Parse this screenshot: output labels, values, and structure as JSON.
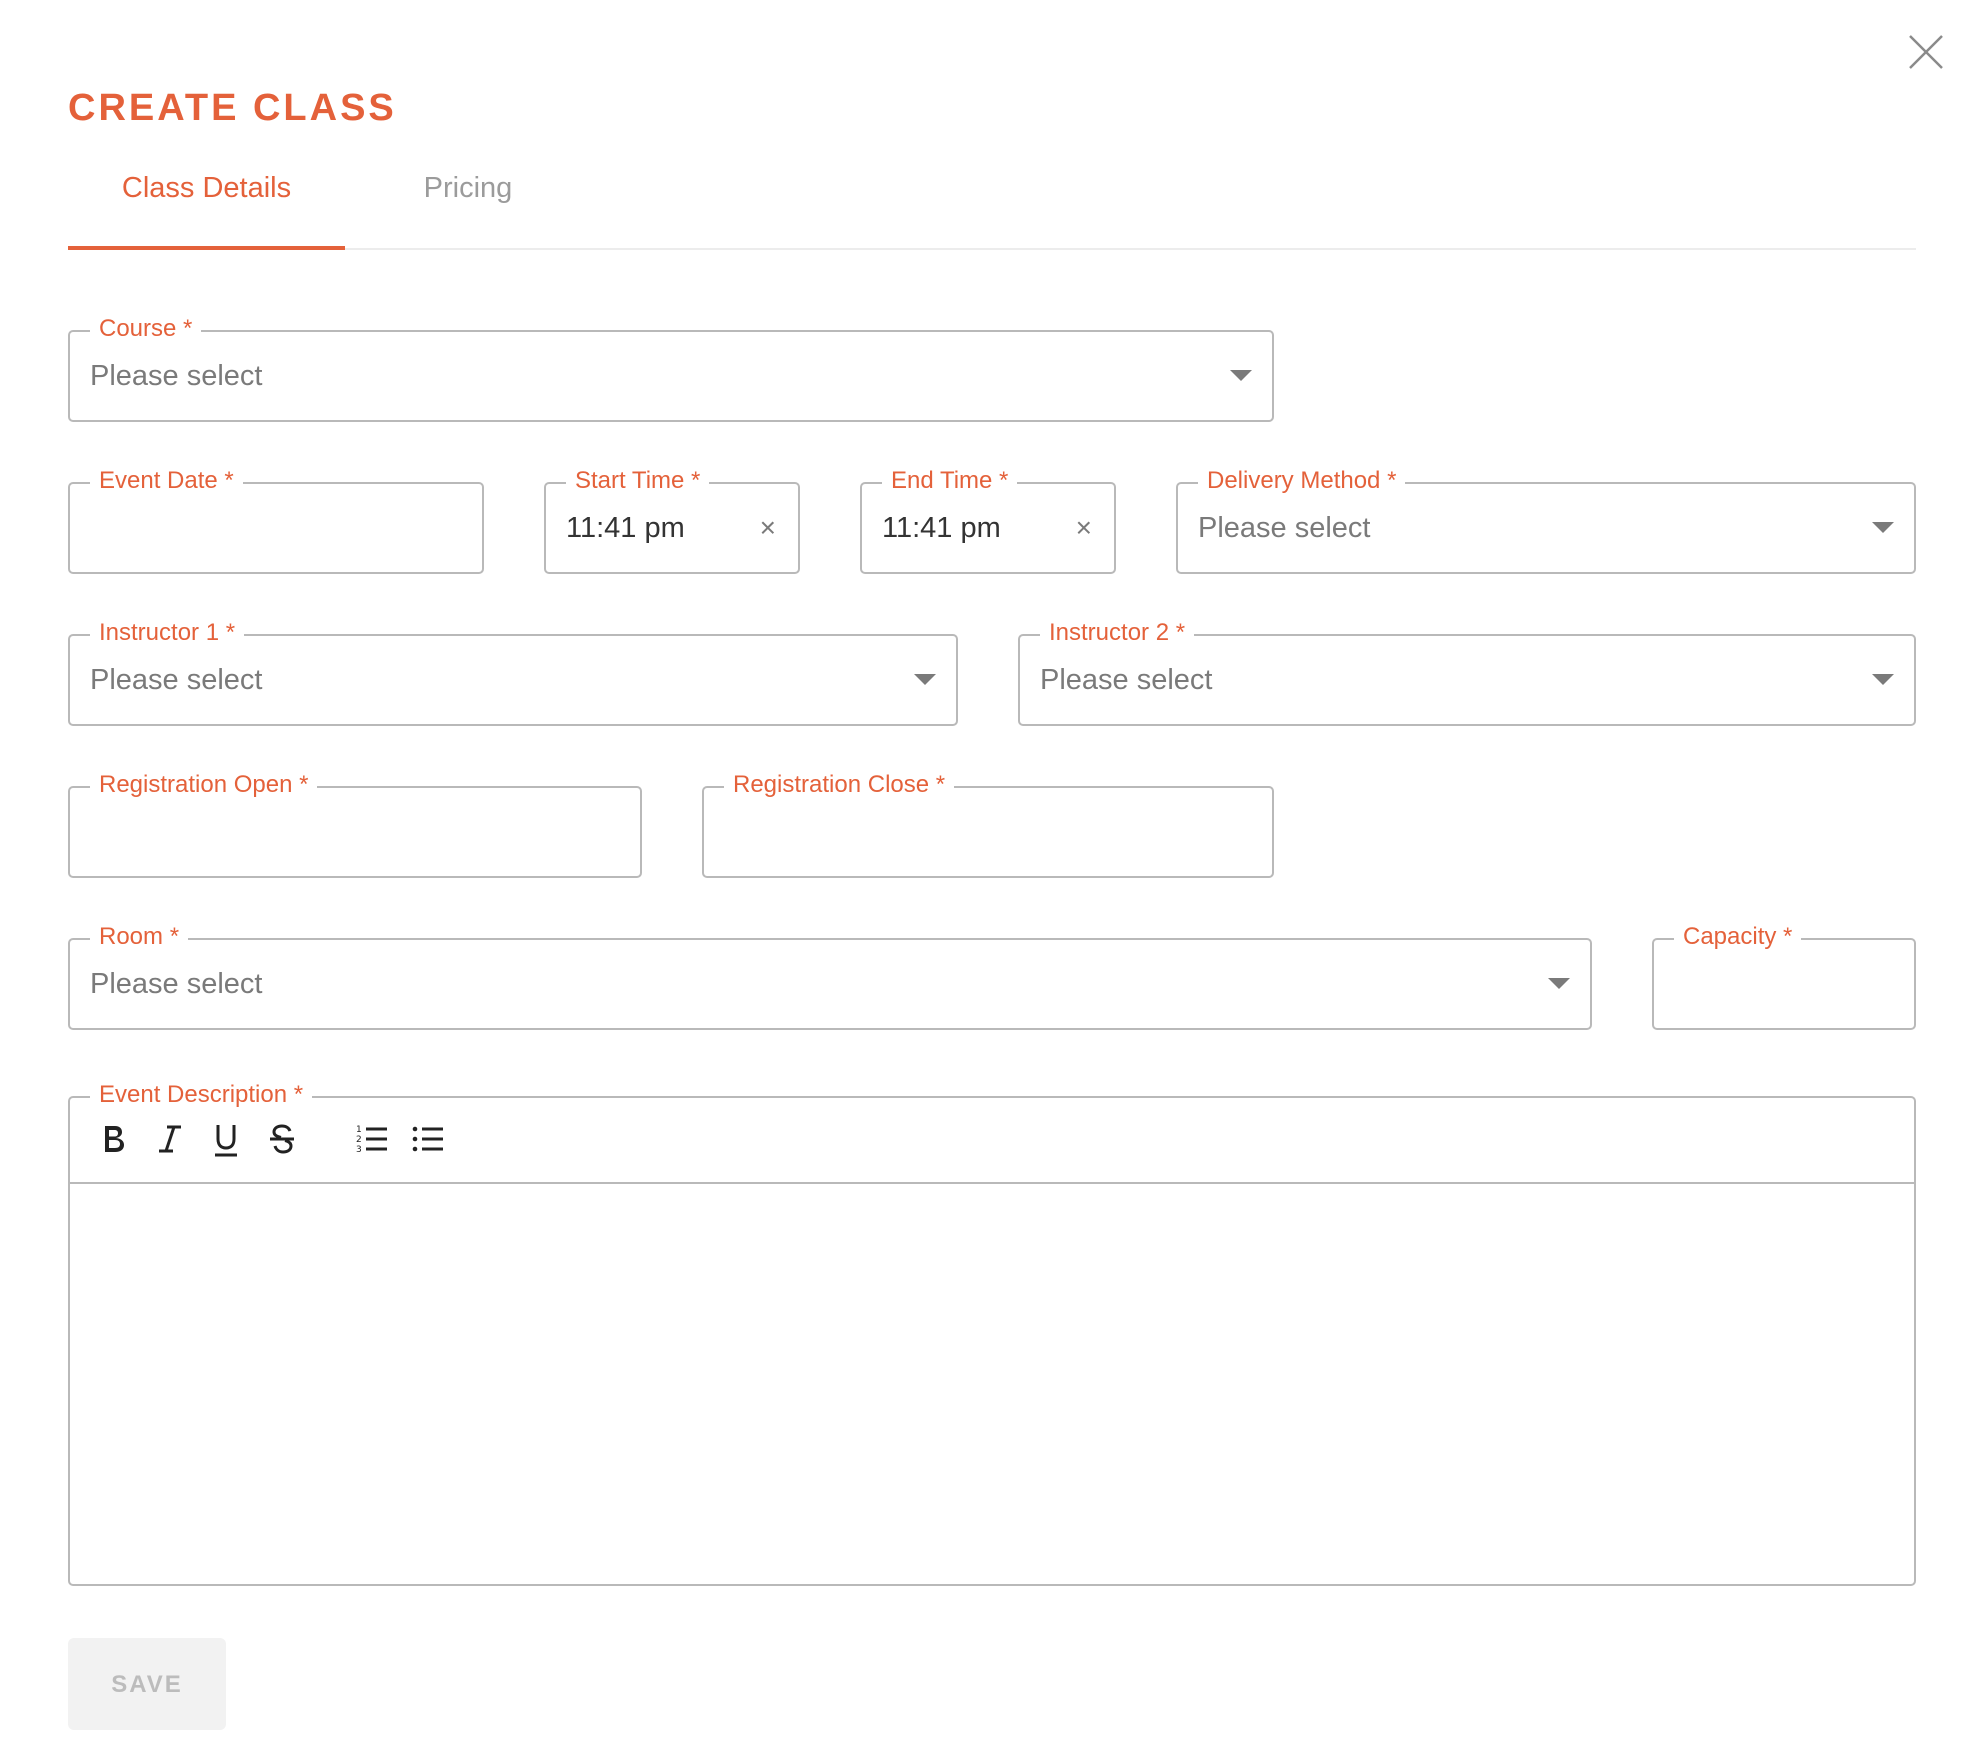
{
  "dialog": {
    "title": "CREATE CLASS",
    "close_icon": "close-icon"
  },
  "tabs": [
    {
      "label": "Class Details",
      "active": true
    },
    {
      "label": "Pricing",
      "active": false
    }
  ],
  "fields": {
    "course": {
      "label": "Course *",
      "placeholder": "Please select"
    },
    "event_date": {
      "label": "Event Date *",
      "value": ""
    },
    "start_time": {
      "label": "Start Time *",
      "value": "11:41 pm",
      "clear_glyph": "×"
    },
    "end_time": {
      "label": "End Time *",
      "value": "11:41 pm",
      "clear_glyph": "×"
    },
    "delivery_method": {
      "label": "Delivery Method *",
      "placeholder": "Please select"
    },
    "instructor_1": {
      "label": "Instructor 1 *",
      "placeholder": "Please select"
    },
    "instructor_2": {
      "label": "Instructor 2 *",
      "placeholder": "Please select"
    },
    "registration_open": {
      "label": "Registration Open *",
      "value": ""
    },
    "registration_close": {
      "label": "Registration Close *",
      "value": ""
    },
    "room": {
      "label": "Room *",
      "placeholder": "Please select"
    },
    "capacity": {
      "label": "Capacity *",
      "value": ""
    },
    "event_description": {
      "label": "Event Description *",
      "toolbar": [
        "bold-icon",
        "italic-icon",
        "underline-icon",
        "strikethrough-icon",
        "ordered-list-icon",
        "bullet-list-icon"
      ]
    }
  },
  "actions": {
    "save_label": "SAVE"
  },
  "colors": {
    "accent": "#e4613a",
    "border": "#b9b9b9",
    "placeholder": "#7a7a7a",
    "inactive_tab": "#9b9b9b",
    "disabled_button_bg": "#f2f2f2",
    "disabled_button_text": "#bcbcbc"
  }
}
